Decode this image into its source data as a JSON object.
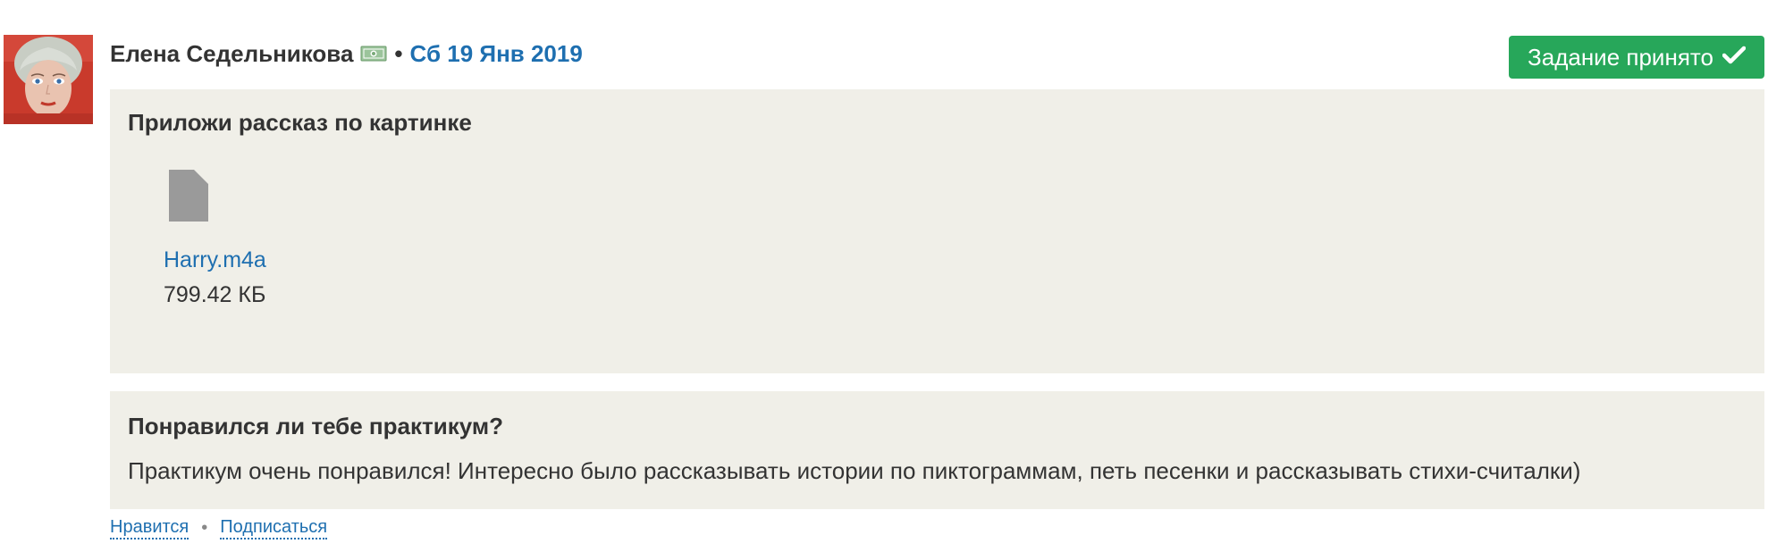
{
  "post": {
    "author": "Елена Седельникова",
    "separator": "•",
    "date": "Сб 19 Янв 2019",
    "status": "Задание принято"
  },
  "icons": {
    "money": "money-icon",
    "check": "check-icon",
    "file": "file-icon"
  },
  "task": {
    "title": "Приложи рассказ по картинке",
    "attachment": {
      "name": "Harry.m4a",
      "size": "799.42 КБ"
    }
  },
  "feedback": {
    "question": "Понравился ли тебе практикум?",
    "answer": "Практикум очень понравился! Интересно было рассказывать истории по пиктограммам, петь песенки и рассказывать стихи-считалки)"
  },
  "actions": {
    "like": "Нравится",
    "dot": "•",
    "subscribe": "Подписаться"
  },
  "colors": {
    "link": "#1e6fb0",
    "badge": "#27a75a",
    "panel": "#f0efe8",
    "text": "#333333"
  }
}
